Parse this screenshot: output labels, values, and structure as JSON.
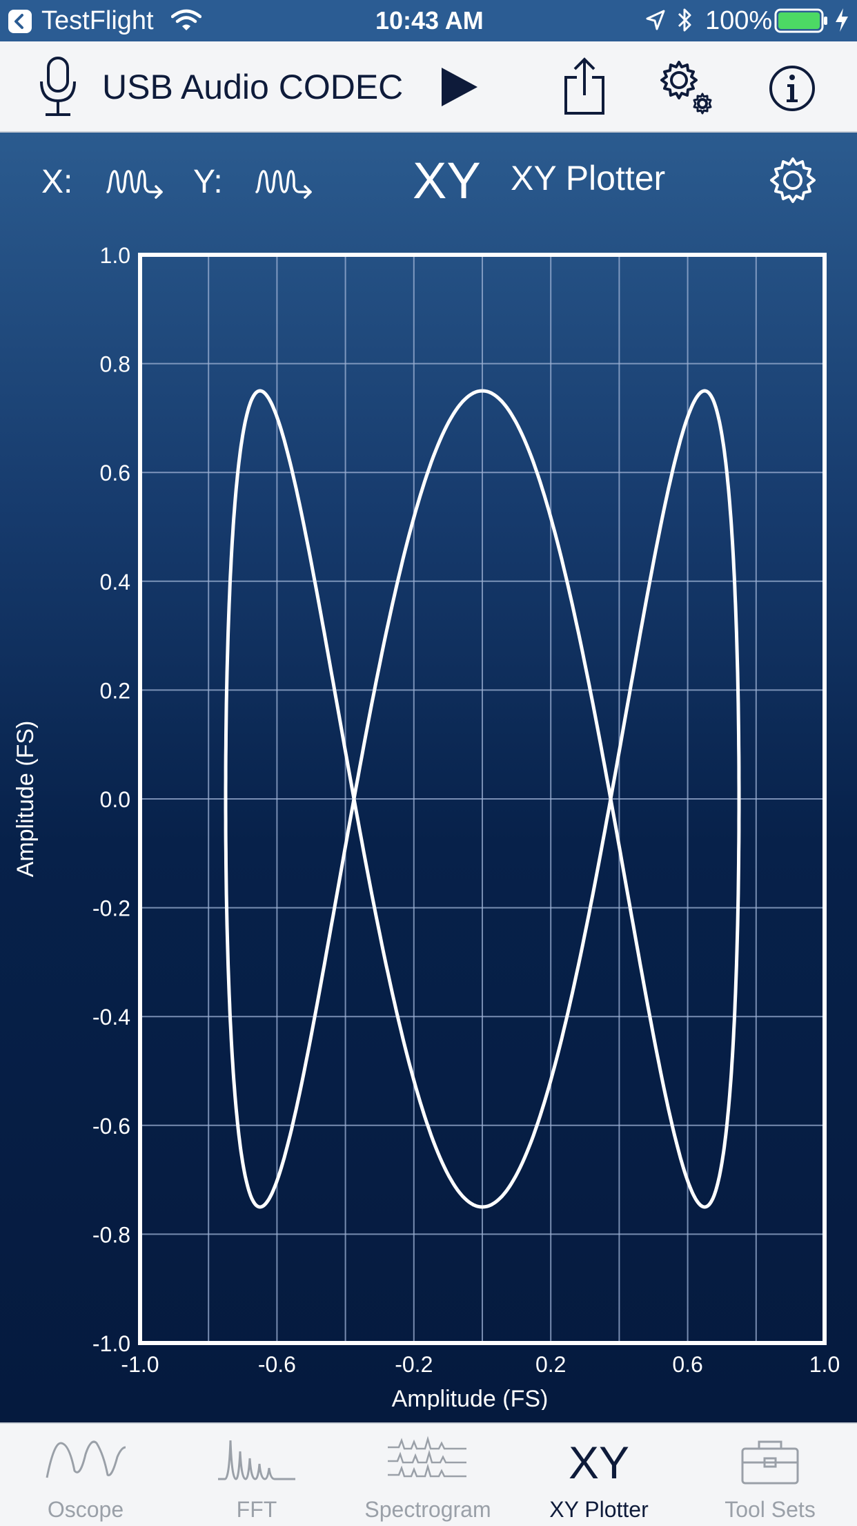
{
  "status_bar": {
    "back_app": "TestFlight",
    "time": "10:43 AM",
    "battery": "100%"
  },
  "toolbar": {
    "device_name": "USB Audio CODEC"
  },
  "controls": {
    "x_label": "X:",
    "y_label": "Y:",
    "mode_short": "XY",
    "mode_name": "XY Plotter"
  },
  "chart_data": {
    "type": "line",
    "xlabel": "Amplitude (FS)",
    "ylabel": "Amplitude (FS)",
    "xlim": [
      -1.0,
      1.0
    ],
    "ylim": [
      -1.0,
      1.0
    ],
    "x_ticks": [
      "-1.0",
      "-0.6",
      "-0.2",
      "0.2",
      "0.6",
      "1.0"
    ],
    "y_ticks": [
      "1.0",
      "0.8",
      "0.6",
      "0.4",
      "0.2",
      "0.0",
      "-0.2",
      "-0.4",
      "-0.6",
      "-0.8",
      "-1.0"
    ],
    "x_grid_step": 0.2,
    "y_grid_step": 0.2,
    "grid": true,
    "series": [
      {
        "curve": "lissajous",
        "x_amplitude": 0.75,
        "y_amplitude": 0.75,
        "x_frequency": 1,
        "y_frequency": 3,
        "phase_deg": 90,
        "color": "#ffffff"
      }
    ]
  },
  "tabs": [
    {
      "label": "Oscope",
      "icon": "sine-wave-icon",
      "active": false
    },
    {
      "label": "FFT",
      "icon": "spectrum-icon",
      "active": false
    },
    {
      "label": "Spectrogram",
      "icon": "spectrogram-icon",
      "active": false
    },
    {
      "label": "XY Plotter",
      "icon": "xy-text-icon",
      "glyph": "XY",
      "active": true
    },
    {
      "label": "Tool Sets",
      "icon": "toolbox-icon",
      "active": false
    }
  ],
  "colors": {
    "accent": "#0e1b3a",
    "status_bar": "#2b5c93",
    "battery_fill": "#4cd964",
    "tab_inactive": "#9aa0a8"
  }
}
